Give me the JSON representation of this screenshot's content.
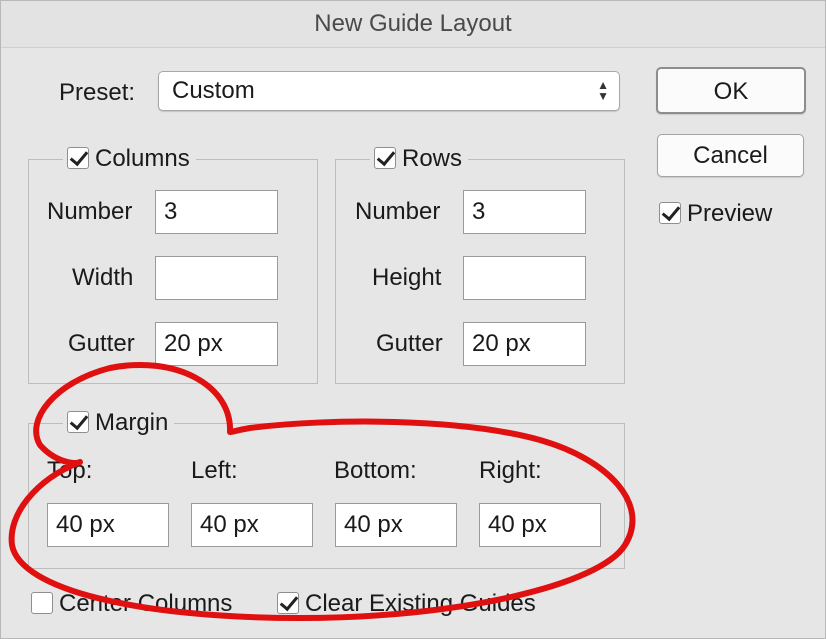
{
  "dialog": {
    "title": "New Guide Layout"
  },
  "preset": {
    "label": "Preset:",
    "value": "Custom",
    "arrows": "▲▼"
  },
  "buttons": {
    "ok": "OK",
    "cancel": "Cancel"
  },
  "preview": {
    "label": "Preview",
    "checked": true
  },
  "columns": {
    "legend": "Columns",
    "checked": true,
    "number_label": "Number",
    "number_value": "3",
    "width_label": "Width",
    "width_value": "",
    "gutter_label": "Gutter",
    "gutter_value": "20 px"
  },
  "rows": {
    "legend": "Rows",
    "checked": true,
    "number_label": "Number",
    "number_value": "3",
    "height_label": "Height",
    "height_value": "",
    "gutter_label": "Gutter",
    "gutter_value": "20 px"
  },
  "margin": {
    "legend": "Margin",
    "checked": true,
    "top_label": "Top:",
    "top_value": "40 px",
    "left_label": "Left:",
    "left_value": "40 px",
    "bottom_label": "Bottom:",
    "bottom_value": "40 px",
    "right_label": "Right:",
    "right_value": "40 px"
  },
  "options": {
    "center_columns": {
      "label": "Center Columns",
      "checked": false
    },
    "clear_guides": {
      "label": "Clear Existing Guides",
      "checked": true
    }
  },
  "annotation_color": "#e01010"
}
